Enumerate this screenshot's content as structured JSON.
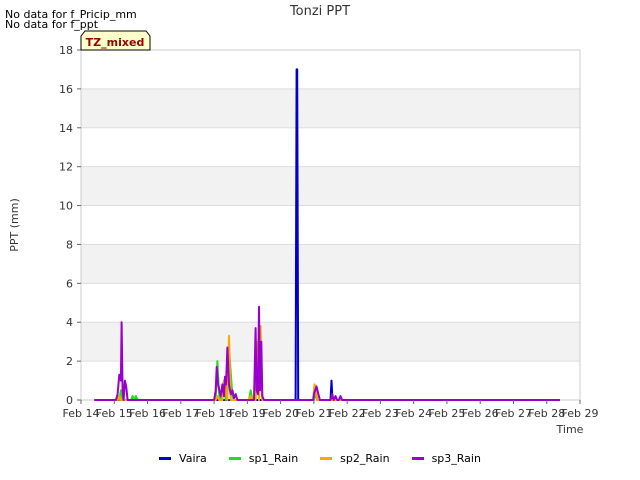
{
  "notices": [
    "No data for f_Pricip_mm",
    "No data for f_ppt"
  ],
  "badge": "TZ_mixed",
  "chart_data": {
    "type": "line",
    "title": "Tonzi PPT",
    "xlabel": "Time",
    "ylabel": "PPT (mm)",
    "ylim": [
      0,
      18
    ],
    "xlim": [
      14,
      29
    ],
    "yticks": [
      0,
      2,
      4,
      6,
      8,
      10,
      12,
      14,
      16,
      18
    ],
    "xticks": [
      14,
      15,
      16,
      17,
      18,
      19,
      20,
      21,
      22,
      23,
      24,
      25,
      26,
      27,
      28,
      29
    ],
    "xtick_labels": [
      "Feb 14",
      "Feb 15",
      "Feb 16",
      "Feb 17",
      "Feb 18",
      "Feb 19",
      "Feb 20",
      "Feb 21",
      "Feb 22",
      "Feb 23",
      "Feb 24",
      "Feb 25",
      "Feb 26",
      "Feb 27",
      "Feb 28",
      "Feb 29"
    ],
    "grid": true,
    "legend_position": "bottom",
    "series": [
      {
        "name": "Vaira",
        "color": "#0000cc",
        "x": [
          14.4,
          20.45,
          20.48,
          20.5,
          20.53,
          20.56,
          20.62,
          21.0,
          21.05,
          21.1,
          21.5,
          21.53,
          21.56,
          21.6,
          28.4
        ],
        "y": [
          0,
          0,
          17,
          17,
          0,
          0,
          0,
          0,
          0.5,
          0,
          0,
          1.0,
          0,
          0,
          0
        ]
      },
      {
        "name": "sp1_Rain",
        "color": "#22dd22",
        "x": [
          14.4,
          15.05,
          15.1,
          15.15,
          15.2,
          15.25,
          15.3,
          15.35,
          15.5,
          15.55,
          15.6,
          15.65,
          15.7,
          15.75,
          18.05,
          18.1,
          18.15,
          18.2,
          18.3,
          18.35,
          18.45,
          18.55,
          18.6,
          18.7,
          19.05,
          19.1,
          19.15,
          19.25,
          19.3,
          19.35,
          19.4,
          19.45,
          20.5,
          20.55,
          21.0,
          21.05,
          21.1,
          21.2,
          21.6,
          21.7,
          28.4
        ],
        "y": [
          0,
          0,
          0.2,
          0,
          0.5,
          0,
          0,
          0,
          0,
          0.2,
          0,
          0.2,
          0,
          0,
          0,
          2.0,
          0.3,
          0,
          1.0,
          0,
          2.7,
          0.2,
          0,
          0,
          0,
          0.5,
          0,
          0,
          2.2,
          0,
          3.0,
          0,
          0,
          0,
          0,
          0.5,
          0,
          0,
          0,
          0,
          0
        ]
      },
      {
        "name": "sp2_Rain",
        "color": "#ffa500",
        "x": [
          14.4,
          15.1,
          15.15,
          15.2,
          18.05,
          18.1,
          18.15,
          18.25,
          18.3,
          18.4,
          18.45,
          18.5,
          19.05,
          19.1,
          19.15,
          19.25,
          19.3,
          19.35,
          19.4,
          19.45,
          19.5,
          20.98,
          21.02,
          21.06,
          21.1,
          21.2,
          28.4
        ],
        "y": [
          0,
          0,
          0.2,
          0,
          0,
          0.2,
          0,
          0,
          1.0,
          0,
          3.3,
          0,
          0,
          0.2,
          0,
          0,
          3.0,
          0,
          3.8,
          0,
          0,
          0,
          0.8,
          0.5,
          0,
          0,
          0
        ]
      },
      {
        "name": "sp3_Rain",
        "color": "#9900cc",
        "x": [
          14.4,
          15.05,
          15.1,
          15.15,
          15.2,
          15.22,
          15.25,
          15.28,
          15.32,
          15.36,
          15.4,
          15.45,
          18.0,
          18.05,
          18.08,
          18.12,
          18.16,
          18.2,
          18.25,
          18.3,
          18.33,
          18.36,
          18.4,
          18.45,
          18.5,
          18.55,
          18.6,
          18.65,
          18.7,
          18.75,
          19.2,
          19.25,
          19.28,
          19.32,
          19.35,
          19.38,
          19.42,
          19.45,
          19.5,
          20.98,
          21.0,
          21.04,
          21.08,
          21.12,
          21.18,
          21.5,
          21.55,
          21.6,
          21.65,
          21.7,
          21.75,
          21.8,
          21.85,
          28.4
        ],
        "y": [
          0,
          0,
          0.3,
          1.3,
          1.0,
          4.0,
          0.5,
          0,
          1.0,
          0.7,
          0,
          0,
          0,
          0.5,
          1.7,
          0.8,
          0.5,
          0.2,
          0.8,
          0.2,
          1.2,
          0.8,
          2.7,
          0.8,
          0.3,
          0.5,
          0.1,
          0.3,
          0,
          0,
          0,
          3.7,
          0.5,
          0.3,
          4.8,
          0.5,
          3.0,
          0.2,
          0,
          0,
          0.3,
          0.5,
          0.7,
          0.4,
          0,
          0,
          0.3,
          0,
          0.2,
          0,
          0,
          0.2,
          0,
          0
        ]
      }
    ]
  }
}
